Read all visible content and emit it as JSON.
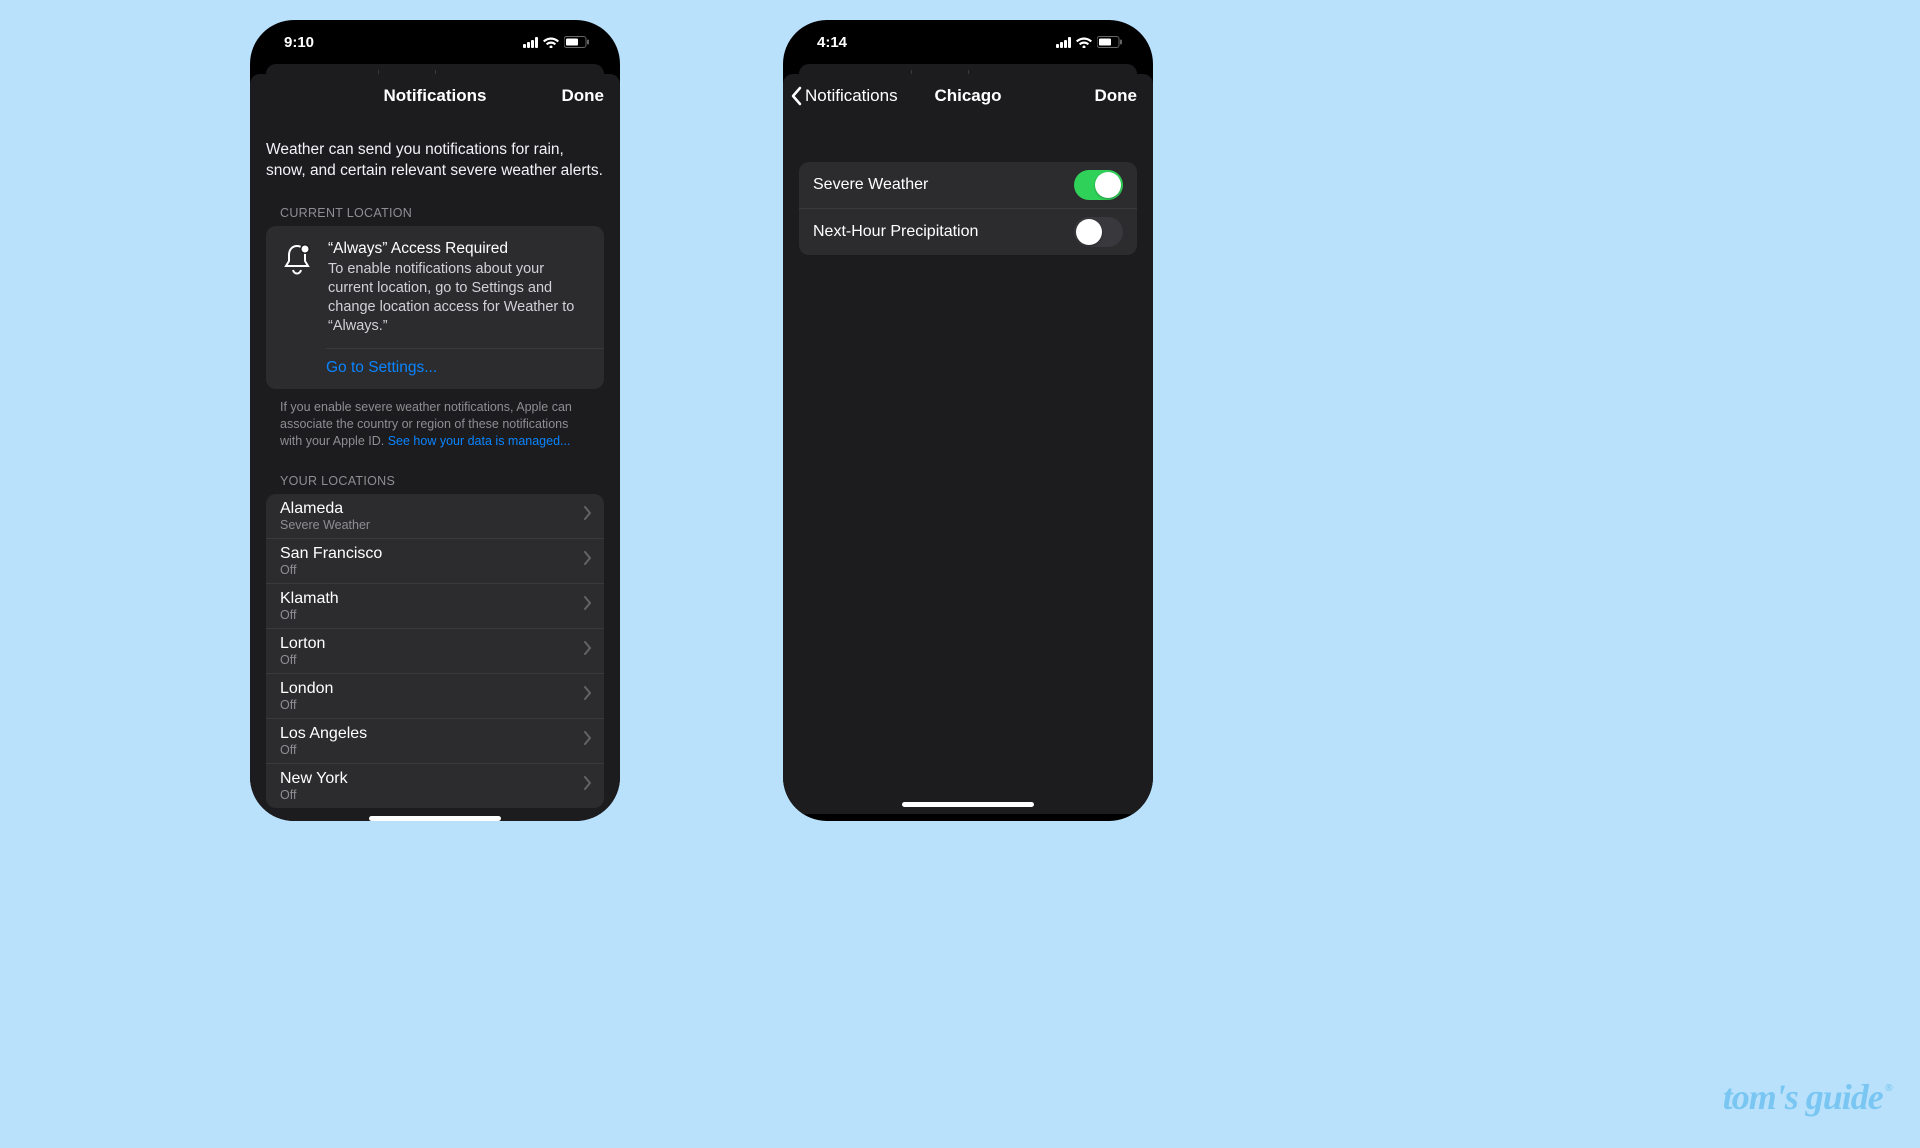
{
  "brand": "tom's guide",
  "left": {
    "status_time": "9:10",
    "nav_title": "Notifications",
    "nav_done": "Done",
    "intro": "Weather can send you notifications for rain, snow, and certain relevant severe weather alerts.",
    "section_current": "CURRENT LOCATION",
    "alert_title": "“Always” Access Required",
    "alert_body": "To enable notifications about your current location, go to Settings and change location access for Weather to “Always.”",
    "settings_link": "Go to Settings...",
    "footer_before": "If you enable severe weather notifications, Apple can associate the country or region of these notifications with your Apple ID. ",
    "footer_link": "See how your data is managed...",
    "section_locations": "YOUR LOCATIONS",
    "locations": [
      {
        "name": "Alameda",
        "status": "Severe Weather"
      },
      {
        "name": "San Francisco",
        "status": "Off"
      },
      {
        "name": "Klamath",
        "status": "Off"
      },
      {
        "name": "Lorton",
        "status": "Off"
      },
      {
        "name": "London",
        "status": "Off"
      },
      {
        "name": "Los Angeles",
        "status": "Off"
      },
      {
        "name": "New York",
        "status": "Off"
      }
    ]
  },
  "right": {
    "status_time": "4:14",
    "nav_back": "Notifications",
    "nav_title": "Chicago",
    "nav_done": "Done",
    "toggles": [
      {
        "label": "Severe Weather",
        "on": true
      },
      {
        "label": "Next-Hour Precipitation",
        "on": false
      }
    ]
  }
}
